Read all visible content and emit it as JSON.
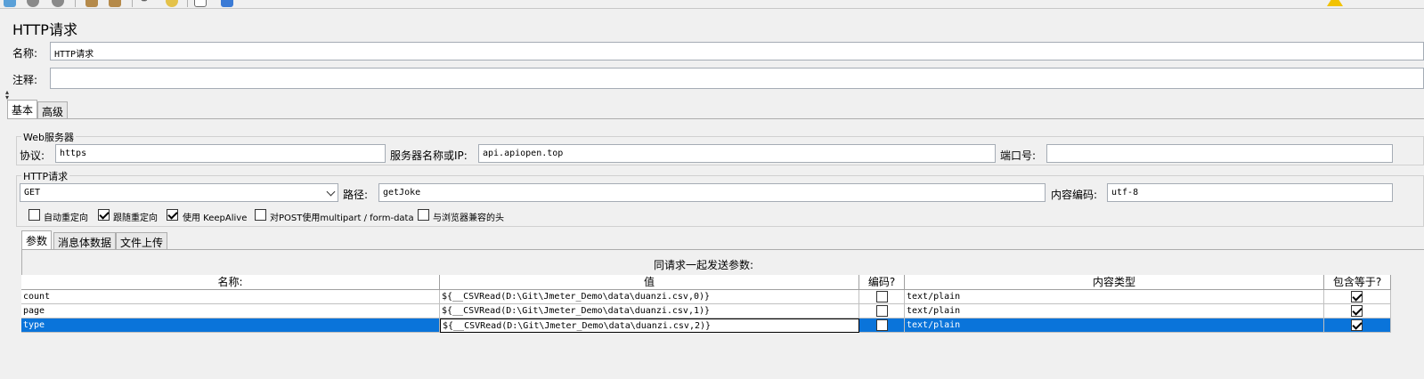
{
  "toolbar": {
    "icons": [
      "run-icon",
      "stop-icon",
      "shutdown-icon",
      "clear-icon",
      "clear-all-icon",
      "search-icon",
      "reset-search-icon",
      "function-helper-icon",
      "help-icon"
    ],
    "warning_icon": "warning-icon"
  },
  "sampler": {
    "title": "HTTP请求",
    "name_label": "名称:",
    "name_value": "HTTP请求",
    "comment_label": "注释:",
    "comment_value": ""
  },
  "tabs": [
    {
      "label": "基本"
    },
    {
      "label": "高级"
    }
  ],
  "web_server": {
    "group_title": "Web服务器",
    "protocol_label": "协议:",
    "protocol_value": "https",
    "server_label": "服务器名称或IP:",
    "server_value": "api.apiopen.top",
    "port_label": "端口号:",
    "port_value": ""
  },
  "http_request": {
    "group_title": "HTTP请求",
    "method": "GET",
    "path_label": "路径:",
    "path_value": "getJoke",
    "encoding_label": "内容编码:",
    "encoding_value": "utf-8",
    "options": [
      {
        "label": "自动重定向",
        "checked": false
      },
      {
        "label": "跟随重定向",
        "checked": true
      },
      {
        "label": "使用 KeepAlive",
        "checked": true
      },
      {
        "label": "对POST使用multipart / form-data",
        "checked": false
      },
      {
        "label": "与浏览器兼容的头",
        "checked": false
      }
    ]
  },
  "sub_tabs": [
    {
      "label": "参数"
    },
    {
      "label": "消息体数据"
    },
    {
      "label": "文件上传"
    }
  ],
  "params_table": {
    "title": "同请求一起发送参数:",
    "columns": [
      "名称:",
      "值",
      "编码?",
      "内容类型",
      "包含等于?"
    ],
    "rows": [
      {
        "name": "count",
        "value": "${__CSVRead(D:\\Git\\Jmeter_Demo\\data\\duanzi.csv,0)}",
        "encode": false,
        "content_type": "text/plain",
        "include_equals": true
      },
      {
        "name": "page",
        "value": "${__CSVRead(D:\\Git\\Jmeter_Demo\\data\\duanzi.csv,1)}",
        "encode": false,
        "content_type": "text/plain",
        "include_equals": true
      },
      {
        "name": "type",
        "value": "${__CSVRead(D:\\Git\\Jmeter_Demo\\data\\duanzi.csv,2)}",
        "encode": false,
        "content_type": "text/plain",
        "include_equals": true
      }
    ],
    "selected_row": 2
  },
  "colors": {
    "selection": "#0a74da",
    "warning": "#f2c200"
  }
}
